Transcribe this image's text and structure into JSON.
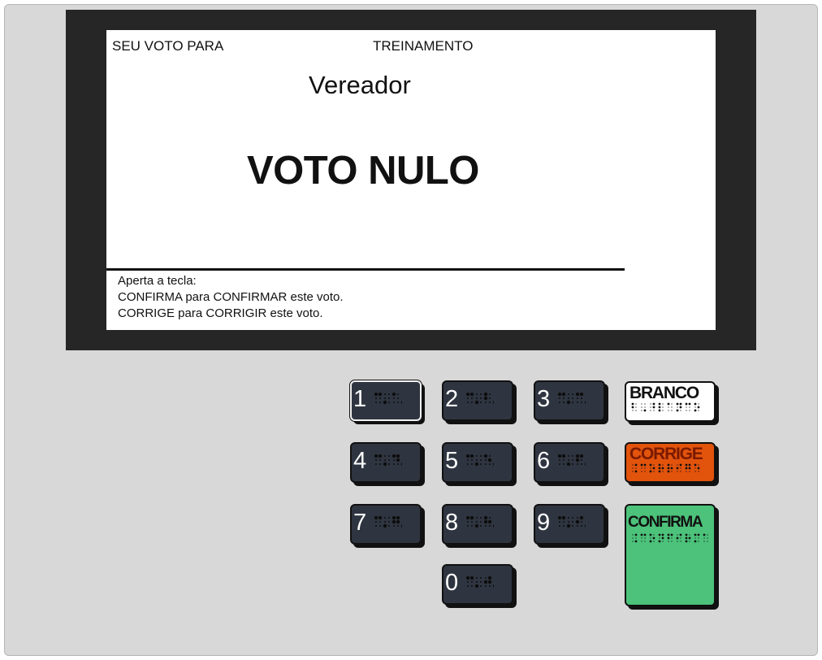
{
  "screen": {
    "header_left": "SEU VOTO PARA",
    "header_center": "TREINAMENTO",
    "cargo": "Vereador",
    "status": "VOTO NULO",
    "instructions": [
      "Aperta a tecla:",
      "CONFIRMA para CONFIRMAR este voto.",
      "CORRIGE para CORRIGIR este voto."
    ]
  },
  "keypad": {
    "digits": [
      "1",
      "2",
      "3",
      "4",
      "5",
      "6",
      "7",
      "8",
      "9",
      "0"
    ],
    "branco": "BRANCO",
    "corrige": "CORRIGE",
    "confirma": "CONFIRMA"
  },
  "colors": {
    "key_dark": "#2f3540",
    "branco": "#ffffff",
    "corrige": "#e2530c",
    "confirma": "#4cc27a"
  },
  "icons": {
    "braille": "braille-dots"
  }
}
